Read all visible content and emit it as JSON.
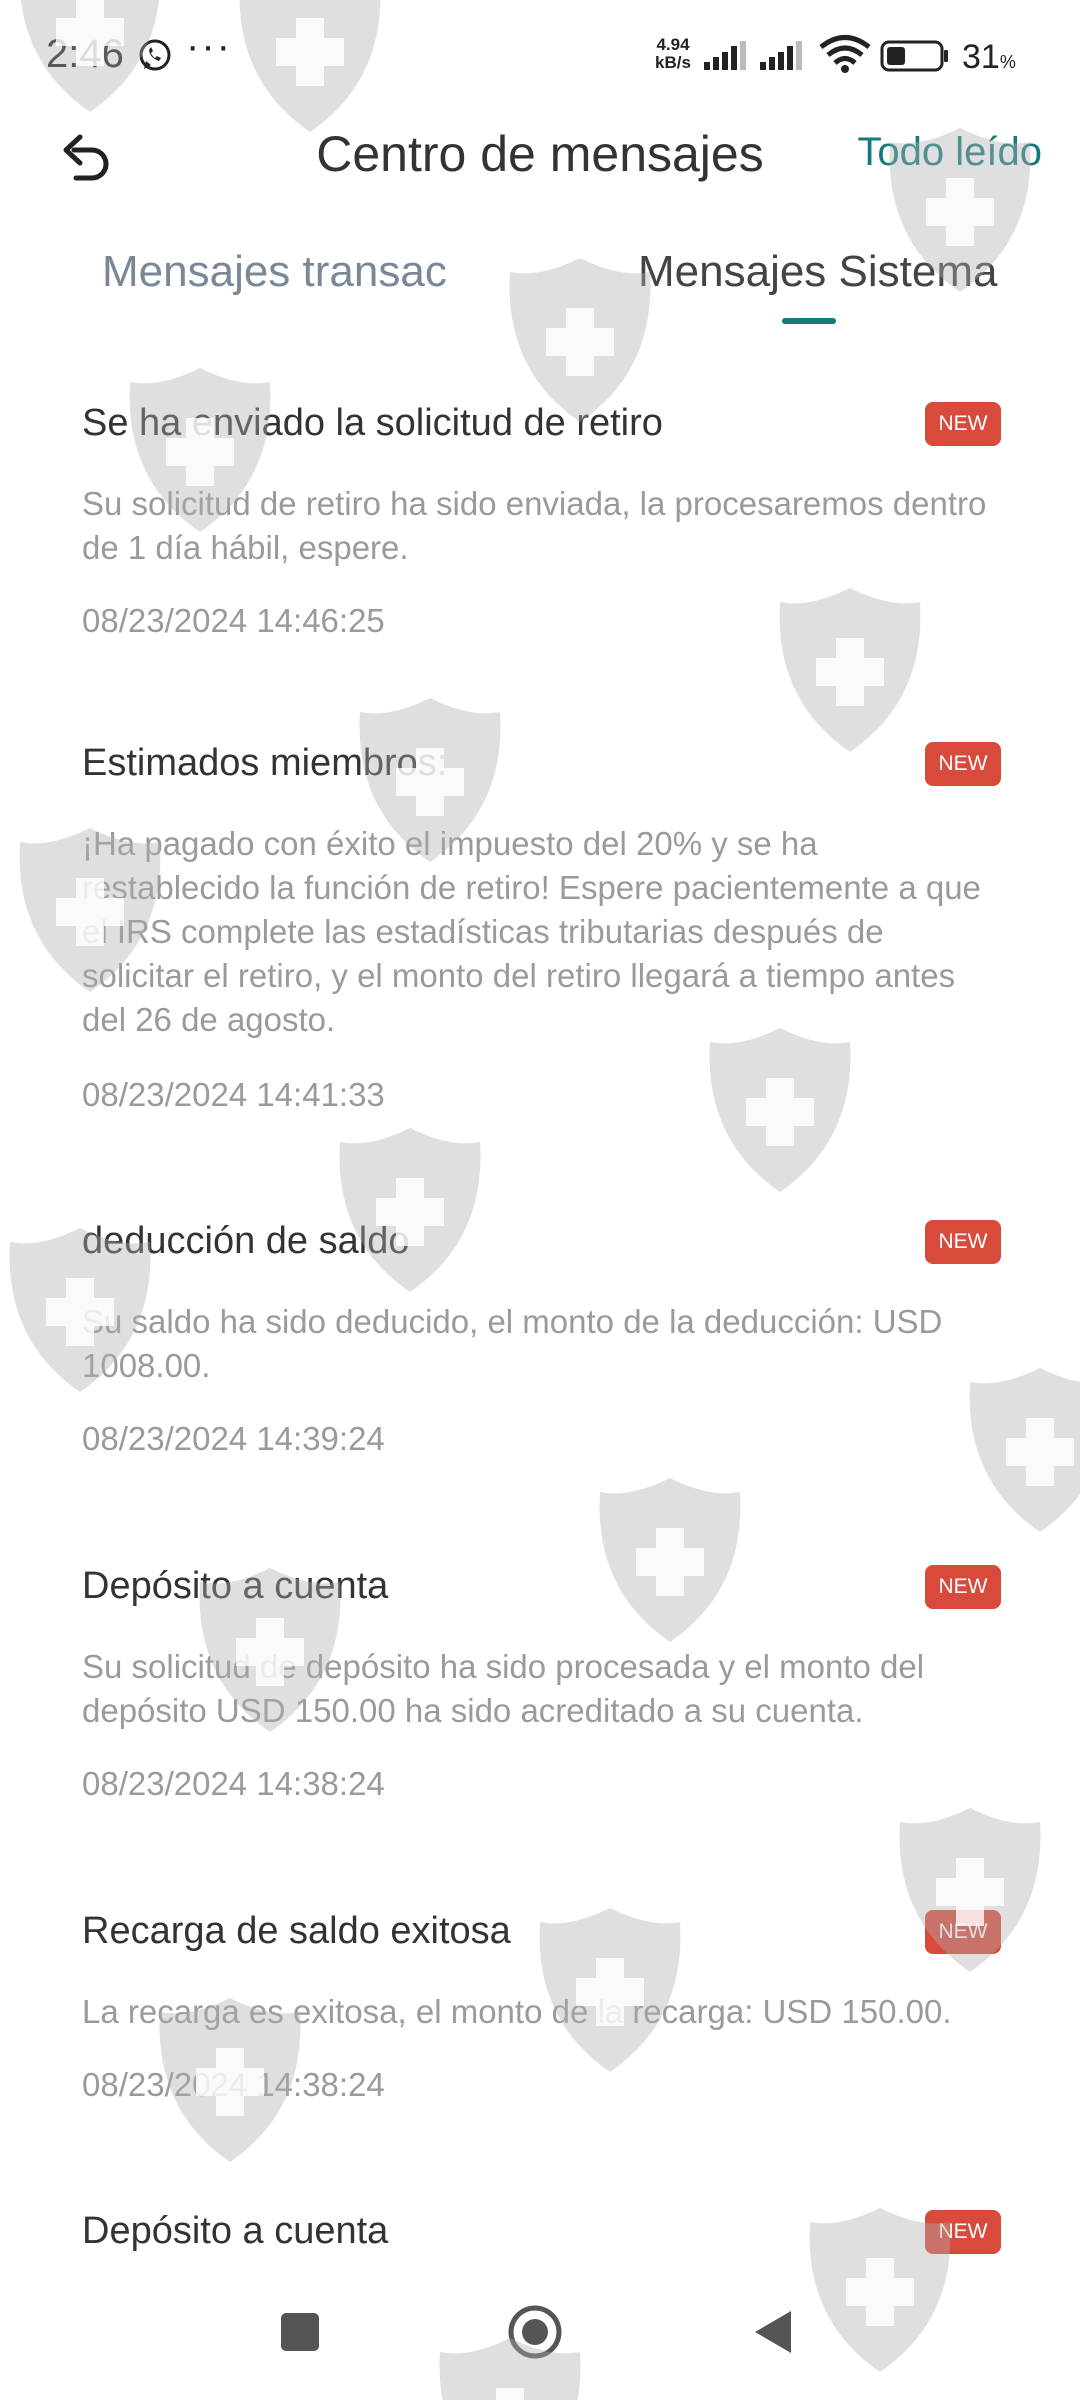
{
  "status_bar": {
    "time": "2:46",
    "notification_icons": [
      "whatsapp-icon",
      "more-dots-icon"
    ],
    "more_dots": "···",
    "speed_value": "4.94",
    "speed_unit": "kB/s",
    "battery_percent": "31",
    "battery_unit": "%"
  },
  "header": {
    "back_icon": "back-arrow-icon",
    "title": "Centro de mensajes",
    "mark_all_read": "Todo leído"
  },
  "tabs": [
    {
      "label": "Mensajes transac",
      "active": false
    },
    {
      "label": "Mensajes Sistema",
      "active": true
    }
  ],
  "colors": {
    "accent": "#147a7c",
    "badge": "#d84a3c",
    "secondary_text": "#9a9a9a",
    "inactive_tab": "#7a8896"
  },
  "badge_label": "NEW",
  "messages": [
    {
      "title": "Se ha enviado la solicitud de retiro",
      "body": "Su solicitud de retiro ha sido enviada, la procesaremos dentro de 1 día hábil, espere.",
      "timestamp": "08/23/2024 14:46:25"
    },
    {
      "title": "Estimados miembros:",
      "body": "¡Ha pagado con éxito el impuesto del 20% y se ha restablecido la función de retiro! Espere pacientemente a que el IRS complete las estadísticas tributarias después de solicitar el retiro, y el monto del retiro llegará a tiempo antes del 26 de agosto.",
      "timestamp": "08/23/2024 14:41:33"
    },
    {
      "title": "deducción de saldo",
      "body": "Su saldo ha sido deducido, el monto de la deducción: USD 1008.00.",
      "timestamp": "08/23/2024 14:39:24"
    },
    {
      "title": "Depósito a cuenta",
      "body": "Su solicitud de depósito ha sido procesada y el monto del depósito USD 150.00 ha sido acreditado a su cuenta.",
      "timestamp": "08/23/2024 14:38:24"
    },
    {
      "title": "Recarga de saldo exitosa",
      "body": "La recarga es exitosa, el monto de la recarga: USD 150.00.",
      "timestamp": "08/23/2024 14:38:24"
    },
    {
      "title": "Depósito a cuenta",
      "body": "",
      "timestamp": ""
    }
  ],
  "nav_bar": [
    "recents-square-icon",
    "home-circle-icon",
    "back-triangle-icon"
  ]
}
